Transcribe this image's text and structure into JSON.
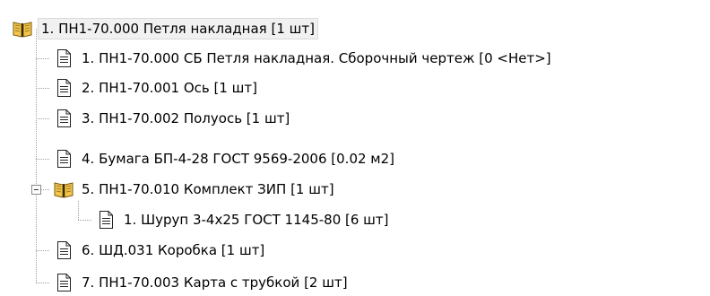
{
  "tree": {
    "root": {
      "label": "1. ПН1-70.000 Петля накладная [1 шт]",
      "icon": "book-icon"
    },
    "children": [
      {
        "label": "1. ПН1-70.000 СБ Петля накладная. Сборочный чертеж [0 <Нет>]",
        "icon": "document-icon"
      },
      {
        "label": "2. ПН1-70.001 Ось [1 шт]",
        "icon": "document-icon"
      },
      {
        "label": "3. ПН1-70.002 Полуось [1 шт]",
        "icon": "document-icon"
      },
      {
        "label": "4.  Бумага БП-4-28 ГОСТ 9569-2006 [0.02 м2]",
        "icon": "document-icon"
      },
      {
        "label": "5. ПН1-70.010 Комплект ЗИП [1 шт]",
        "icon": "book-icon",
        "expanded": true,
        "children": [
          {
            "label": "1.  Шуруп 3-4х25 ГОСТ 1145-80 [6 шт]",
            "icon": "document-icon"
          }
        ]
      },
      {
        "label": "6. ШД.031 Коробка [1 шт]",
        "icon": "document-icon"
      },
      {
        "label": "7. ПН1-70.003 Карта с трубкой [2 шт]",
        "icon": "document-icon"
      }
    ]
  }
}
